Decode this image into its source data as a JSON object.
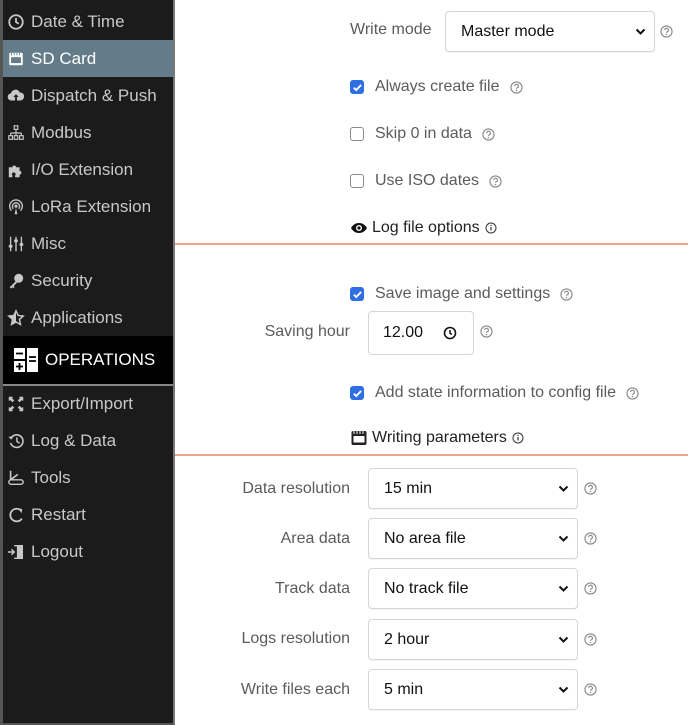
{
  "sidebar": {
    "items_top": [
      {
        "label": "Date & Time",
        "icon": "clock-icon",
        "active": false
      },
      {
        "label": "SD Card",
        "icon": "sd-card-icon",
        "active": true
      },
      {
        "label": "Dispatch & Push",
        "icon": "cloud-upload-icon",
        "active": false
      },
      {
        "label": "Modbus",
        "icon": "network-icon",
        "active": false
      },
      {
        "label": "I/O Extension",
        "icon": "puzzle-icon",
        "active": false
      },
      {
        "label": "LoRa Extension",
        "icon": "antenna-icon",
        "active": false
      },
      {
        "label": "Misc",
        "icon": "sliders-icon",
        "active": false
      },
      {
        "label": "Security",
        "icon": "key-icon",
        "active": false
      },
      {
        "label": "Applications",
        "icon": "star-icon",
        "active": false
      }
    ],
    "section_header": {
      "label": "OPERATIONS",
      "icon": "calculator-icon"
    },
    "items_bottom": [
      {
        "label": "Export/Import",
        "icon": "expand-arrows-icon"
      },
      {
        "label": "Log & Data",
        "icon": "history-icon"
      },
      {
        "label": "Tools",
        "icon": "tools-icon"
      },
      {
        "label": "Restart",
        "icon": "restart-icon"
      },
      {
        "label": "Logout",
        "icon": "logout-icon"
      }
    ]
  },
  "form": {
    "write_mode": {
      "label": "Write mode",
      "value": "Master mode"
    },
    "always_create_file": {
      "label": "Always create file",
      "checked": true
    },
    "skip_zero": {
      "label": "Skip 0 in data",
      "checked": false
    },
    "use_iso_dates": {
      "label": "Use ISO dates",
      "checked": false
    },
    "log_file_options": {
      "title": "Log file options",
      "icon": "eye-icon"
    },
    "save_image_settings": {
      "label": "Save image and settings",
      "checked": true
    },
    "saving_hour": {
      "label": "Saving hour",
      "value": "12.00"
    },
    "add_state_info": {
      "label": "Add state information to config file",
      "checked": true
    },
    "writing_parameters": {
      "title": "Writing parameters",
      "icon": "sd-card-icon"
    },
    "data_resolution": {
      "label": "Data resolution",
      "value": "15 min"
    },
    "area_data": {
      "label": "Area data",
      "value": "No area file"
    },
    "track_data": {
      "label": "Track data",
      "value": "No track file"
    },
    "logs_resolution": {
      "label": "Logs resolution",
      "value": "2 hour"
    },
    "write_files_each": {
      "label": "Write files each",
      "value": "5 min"
    }
  },
  "colors": {
    "sidebar_bg": "#1b1b1b",
    "sidebar_active": "#647c8a",
    "checkbox_blue": "#2f6fe4",
    "separator": "#eea38a"
  }
}
